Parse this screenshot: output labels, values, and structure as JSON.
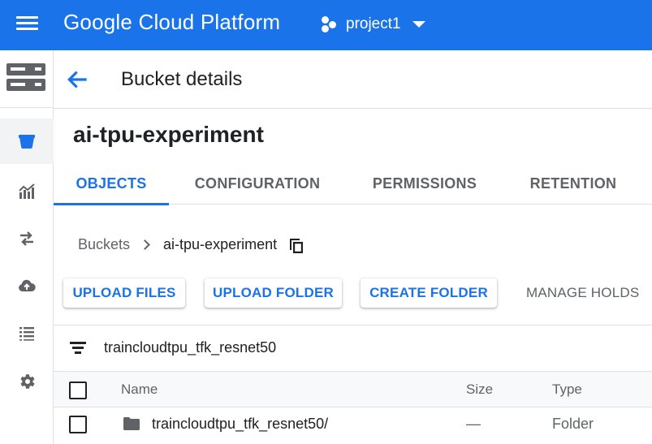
{
  "app": {
    "name": "Google Cloud Platform",
    "project": "project1",
    "brand_color": "#1a73e8"
  },
  "rail": {
    "logo_icon": "storage-icon",
    "items": [
      {
        "icon": "bucket-icon",
        "active": true
      },
      {
        "icon": "monitoring-icon",
        "active": false
      },
      {
        "icon": "transfer-icon",
        "active": false
      },
      {
        "icon": "cloud-upload-icon",
        "active": false
      },
      {
        "icon": "list-icon",
        "active": false
      },
      {
        "icon": "gear-icon",
        "active": false
      }
    ]
  },
  "header": {
    "title": "Bucket details",
    "back_icon": "arrow-back-icon"
  },
  "bucket": {
    "name": "ai-tpu-experiment"
  },
  "tabs": [
    {
      "label": "OBJECTS",
      "active": true
    },
    {
      "label": "CONFIGURATION",
      "active": false
    },
    {
      "label": "PERMISSIONS",
      "active": false
    },
    {
      "label": "RETENTION",
      "active": false
    }
  ],
  "breadcrumb": {
    "root": "Buckets",
    "current": "ai-tpu-experiment",
    "copy_icon": "copy-icon"
  },
  "actions": {
    "upload_files": "UPLOAD FILES",
    "upload_folder": "UPLOAD FOLDER",
    "create_folder": "CREATE FOLDER",
    "manage_holds": "MANAGE HOLDS"
  },
  "filter": {
    "icon": "filter-icon",
    "value": "traincloudtpu_tfk_resnet50"
  },
  "table": {
    "columns": {
      "name": "Name",
      "size": "Size",
      "type": "Type"
    },
    "rows": [
      {
        "name": "traincloudtpu_tfk_resnet50/",
        "size": "—",
        "type": "Folder",
        "icon": "folder-icon"
      }
    ]
  }
}
